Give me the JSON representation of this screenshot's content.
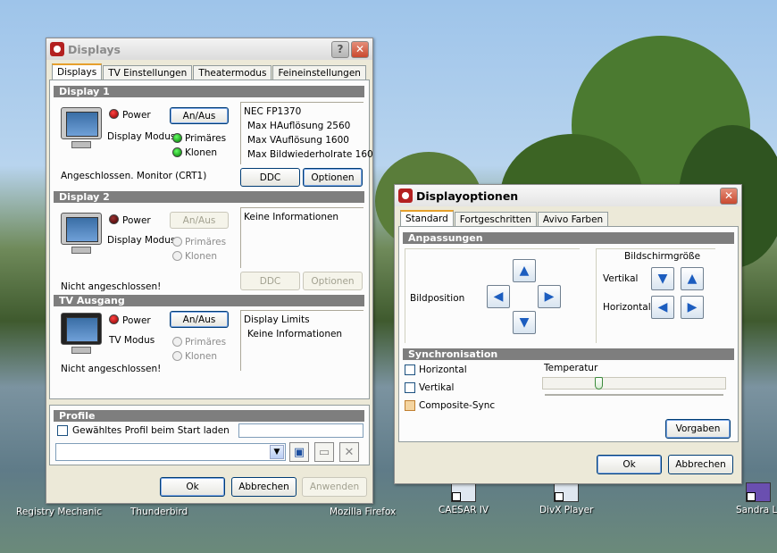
{
  "desktop": {
    "icons": [
      {
        "label": "Registry Mechanic"
      },
      {
        "label": "Thunderbird"
      },
      {
        "label": "Mozilla Firefox"
      },
      {
        "label": "CAESAR IV"
      },
      {
        "label": "DivX Player"
      },
      {
        "label": "Sandra Li"
      }
    ]
  },
  "displays": {
    "title": "Displays",
    "tabs": [
      "Displays",
      "TV Einstellungen",
      "Theatermodus",
      "Feineinstellungen"
    ],
    "display1": {
      "header": "Display 1",
      "power_label": "Power",
      "onoff_label": "An/Aus",
      "mode_label": "Display Modus",
      "primary_label": "Primäres",
      "clone_label": "Klonen",
      "status": "Angeschlossen. Monitor (CRT1)",
      "ddc_label": "DDC",
      "options_label": "Optionen",
      "info": [
        "NEC FP1370",
        "Max HAuflösung 2560",
        "Max VAuflösung 1600",
        "Max Bildwiederholrate 160"
      ]
    },
    "display2": {
      "header": "Display 2",
      "power_label": "Power",
      "onoff_label": "An/Aus",
      "mode_label": "Display Modus",
      "primary_label": "Primäres",
      "clone_label": "Klonen",
      "status": "Nicht angeschlossen!",
      "ddc_label": "DDC",
      "options_label": "Optionen",
      "info": [
        "Keine Informationen"
      ]
    },
    "tv": {
      "header": "TV Ausgang",
      "power_label": "Power",
      "onoff_label": "An/Aus",
      "mode_label": "TV Modus",
      "primary_label": "Primäres",
      "clone_label": "Klonen",
      "status": "Nicht angeschlossen!",
      "info": [
        "Display Limits",
        "Keine Informationen"
      ]
    },
    "profile": {
      "header": "Profile",
      "load_label": "Gewähltes Profil beim Start laden"
    },
    "ok_label": "Ok",
    "cancel_label": "Abbrechen",
    "apply_label": "Anwenden"
  },
  "options": {
    "title": "Displayoptionen",
    "tabs": [
      "Standard",
      "Fortgeschritten",
      "Avivo Farben"
    ],
    "adjust_header": "Anpassungen",
    "position_label": "Bildposition",
    "size_label": "Bildschirmgröße",
    "vertical_label": "Vertikal",
    "horizontal_label": "Horizontal",
    "sync_header": "Synchronisation",
    "sync_horizontal": "Horizontal",
    "sync_vertical": "Vertikal",
    "sync_composite": "Composite-Sync",
    "temperature_label": "Temperatur",
    "temperature_level": 0.3,
    "defaults_label": "Vorgaben",
    "ok_label": "Ok",
    "cancel_label": "Abbrechen"
  }
}
